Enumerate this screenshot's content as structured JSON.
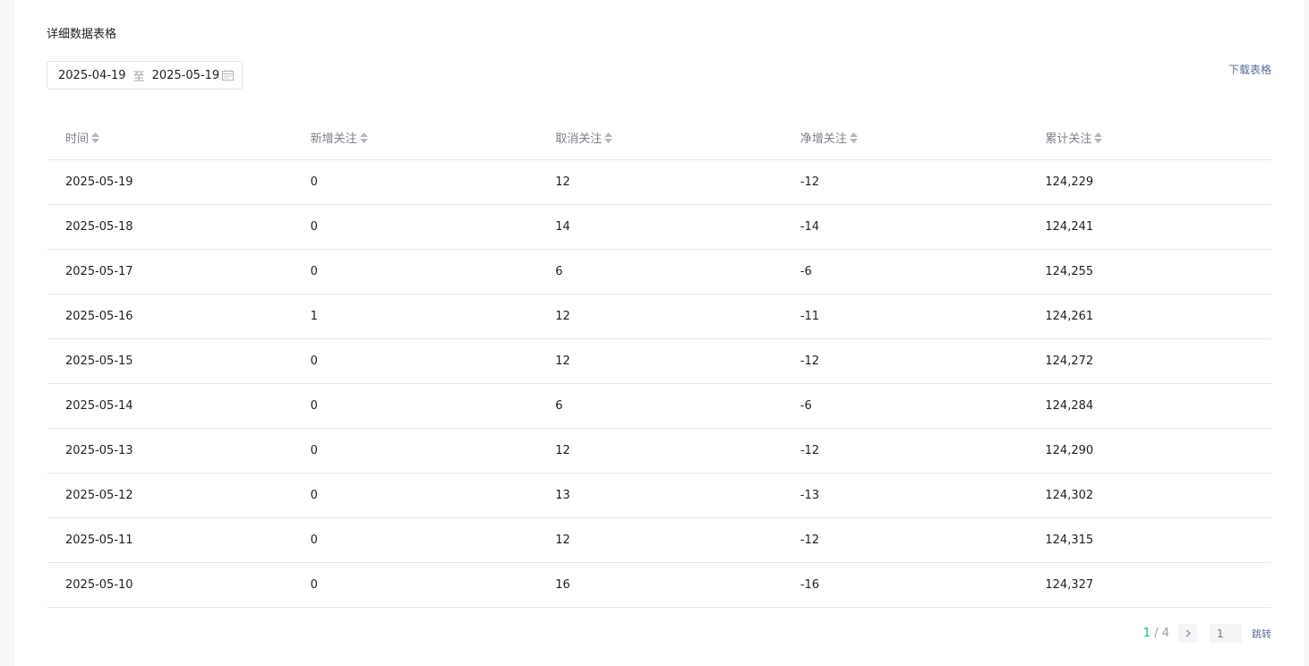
{
  "section": {
    "title": "详细数据表格"
  },
  "date_range": {
    "start": "2025-04-19",
    "separator": "至",
    "end": "2025-05-19",
    "icon": "calendar-icon"
  },
  "download": {
    "label": "下载表格"
  },
  "table": {
    "columns": [
      "时间",
      "新增关注",
      "取消关注",
      "净增关注",
      "累计关注"
    ],
    "rows": [
      [
        "2025-05-19",
        "0",
        "12",
        "-12",
        "124,229"
      ],
      [
        "2025-05-18",
        "0",
        "14",
        "-14",
        "124,241"
      ],
      [
        "2025-05-17",
        "0",
        "6",
        "-6",
        "124,255"
      ],
      [
        "2025-05-16",
        "1",
        "12",
        "-11",
        "124,261"
      ],
      [
        "2025-05-15",
        "0",
        "12",
        "-12",
        "124,272"
      ],
      [
        "2025-05-14",
        "0",
        "6",
        "-6",
        "124,284"
      ],
      [
        "2025-05-13",
        "0",
        "12",
        "-12",
        "124,290"
      ],
      [
        "2025-05-12",
        "0",
        "13",
        "-13",
        "124,302"
      ],
      [
        "2025-05-11",
        "0",
        "12",
        "-12",
        "124,315"
      ],
      [
        "2025-05-10",
        "0",
        "16",
        "-16",
        "124,327"
      ]
    ]
  },
  "pagination": {
    "current": "1",
    "separator": " / ",
    "total": "4",
    "input_placeholder": "1",
    "jump_label": "跳转"
  },
  "colors": {
    "accent_green": "#07c160",
    "link_blue": "#576b95"
  }
}
